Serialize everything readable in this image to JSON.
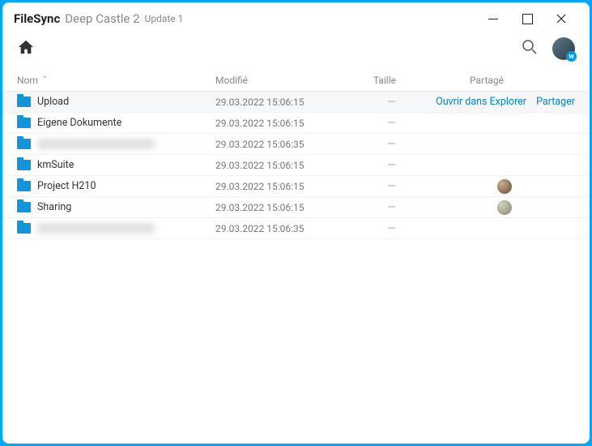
{
  "title": {
    "app": "FileSync",
    "sub": "Deep Castle 2",
    "update": "Update 1"
  },
  "headers": {
    "name": "Nom",
    "modified": "Modifié",
    "size": "Taille",
    "shared": "Partagé"
  },
  "actions": {
    "open_explorer": "Ouvrir dans Explorer",
    "share": "Partager"
  },
  "rows": [
    {
      "name": "Upload",
      "modified": "29.03.2022 15:06:15",
      "size": "—",
      "hover": true,
      "blurred": false,
      "shared_avatar": null
    },
    {
      "name": "Eigene Dokumente",
      "modified": "29.03.2022 15:06:15",
      "size": "—",
      "hover": false,
      "blurred": false,
      "shared_avatar": null
    },
    {
      "name": "",
      "modified": "29.03.2022 15:06:35",
      "size": "—",
      "hover": false,
      "blurred": true,
      "shared_avatar": null
    },
    {
      "name": "kmSuite",
      "modified": "29.03.2022 15:06:15",
      "size": "—",
      "hover": false,
      "blurred": false,
      "shared_avatar": null
    },
    {
      "name": "Project H210",
      "modified": "29.03.2022 15:06:15",
      "size": "—",
      "hover": false,
      "blurred": false,
      "shared_avatar": "a"
    },
    {
      "name": "Sharing",
      "modified": "29.03.2022 15:06:15",
      "size": "—",
      "hover": false,
      "blurred": false,
      "shared_avatar": "b"
    },
    {
      "name": "",
      "modified": "29.03.2022 15:06:35",
      "size": "—",
      "hover": false,
      "blurred": true,
      "shared_avatar": null
    }
  ]
}
